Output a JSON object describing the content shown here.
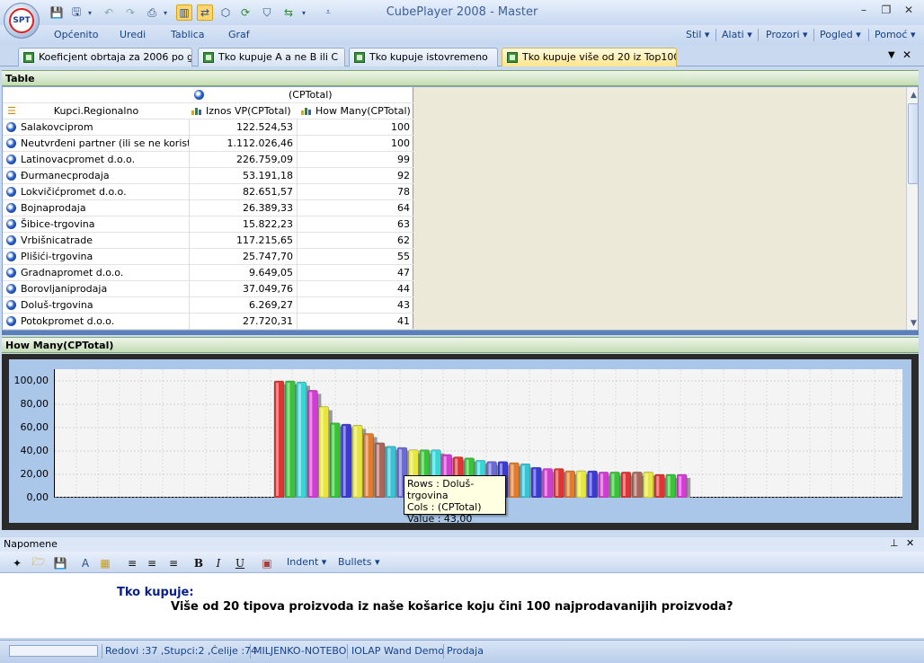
{
  "window": {
    "title": "CubePlayer 2008 - Master",
    "logo_text": "SPT",
    "minimize": "–",
    "restore": "❐",
    "close": "✕"
  },
  "menu": {
    "left": [
      "Općenito",
      "Uredi",
      "Tablica",
      "Graf"
    ],
    "right": [
      "Stil",
      "Alati",
      "Prozori",
      "Pogled",
      "Pomoć"
    ]
  },
  "tabs": [
    {
      "label": "Koeficjent obrtaja za 2006 po g..."
    },
    {
      "label": "Tko kupuje A a ne B ili C"
    },
    {
      "label": "Tko kupuje istovremeno"
    },
    {
      "label": "Tko kupuje više od 20 iz Top100..."
    }
  ],
  "table_panel": {
    "title": "Table",
    "group_header": "(CPTotal)",
    "row_dimension": "Kupci.Regionalno",
    "col1": "Iznos VP(CPTotal)",
    "col2": "How Many(CPTotal)",
    "rows": [
      {
        "name": "Salakovciprom",
        "iznos": "122.524,53",
        "count": "100"
      },
      {
        "name": "Neutvrđeni partner (ili se ne koristi)",
        "iznos": "1.112.026,46",
        "count": "100"
      },
      {
        "name": "Latinovacpromet d.o.o.",
        "iznos": "226.759,09",
        "count": "99"
      },
      {
        "name": "Đurmanecprodaja",
        "iznos": "53.191,18",
        "count": "92"
      },
      {
        "name": "Lokvičićpromet d.o.o.",
        "iznos": "82.651,57",
        "count": "78"
      },
      {
        "name": "Bojnaprodaja",
        "iznos": "26.389,33",
        "count": "64"
      },
      {
        "name": "Šibice-trgovina",
        "iznos": "15.822,23",
        "count": "63"
      },
      {
        "name": "Vrbišnicatrade",
        "iznos": "117.215,65",
        "count": "62"
      },
      {
        "name": "Plišići-trgovina",
        "iznos": "25.747,70",
        "count": "55"
      },
      {
        "name": "Gradnapromet d.o.o.",
        "iznos": "9.649,05",
        "count": "47"
      },
      {
        "name": "Borovljaniprodaja",
        "iznos": "37.049,76",
        "count": "44"
      },
      {
        "name": "Doluš-trgovina",
        "iznos": "6.269,27",
        "count": "43"
      },
      {
        "name": "Potokpromet d.o.o.",
        "iznos": "27.720,31",
        "count": "41"
      }
    ]
  },
  "chart_panel": {
    "title": "How Many(CPTotal)",
    "tooltip": {
      "rows": "Rows : Doluš-trgovina",
      "cols": "Cols : (CPTotal)",
      "value": "Value : 43,00"
    }
  },
  "chart_data": {
    "type": "bar",
    "ylim": [
      0,
      110
    ],
    "yticks": [
      "0,00",
      "20,00",
      "40,00",
      "60,00",
      "80,00",
      "100,00"
    ],
    "values": [
      100,
      100,
      99,
      92,
      78,
      64,
      63,
      62,
      55,
      47,
      44,
      43,
      41,
      41,
      41,
      37,
      35,
      34,
      32,
      31,
      31,
      30,
      29,
      26,
      25,
      25,
      23,
      23,
      23,
      22,
      22,
      22,
      22,
      22,
      20,
      20,
      20
    ],
    "colors": [
      "#e03434",
      "#38c438",
      "#35d6d6",
      "#d43bd4",
      "#e6e63b",
      "#34c434",
      "#3a3ad6",
      "#e6e63b",
      "#e07b2e",
      "#a8675a",
      "#35c4d6",
      "#6a6ad6",
      "#e6e63b",
      "#38c438",
      "#35d6d6",
      "#d43bd4",
      "#e03434",
      "#38c438",
      "#35d6d6",
      "#6a6ad6",
      "#3a3ad6",
      "#e07b2e",
      "#35c4d6",
      "#3a3ad6",
      "#d43bd4",
      "#e03434",
      "#e07b2e",
      "#e6e63b",
      "#3a3ad6",
      "#d43bd4",
      "#38c438",
      "#e03434",
      "#a8675a",
      "#e6e63b",
      "#e03434",
      "#38c438",
      "#d43bd4"
    ]
  },
  "notes": {
    "title": "Napomene",
    "indent": "Indent",
    "bullets": "Bullets",
    "heading": "Tko kupuje:",
    "text": "Više od 20 tipova proizvoda iz naše košarice koju čini 100 najprodavanijih proizvoda?"
  },
  "status": {
    "counts": "Redovi :37 ,Stupci:2 ,Ćelije :74",
    "machine": "MILJENKO-NOTEBO",
    "server": "IOLAP Wand Demo",
    "cube": "Prodaja"
  }
}
